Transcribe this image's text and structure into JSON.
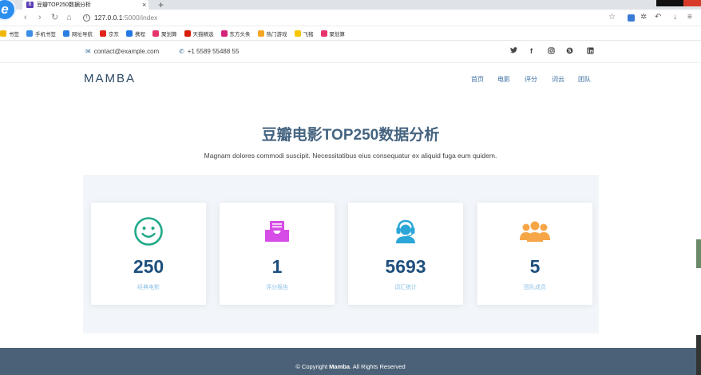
{
  "browser": {
    "tab_favicon": "B",
    "tab_title": "豆瓣TOP250数据分析",
    "tab_close": "×",
    "new_tab": "+",
    "logo_letter": "e",
    "back": "‹",
    "forward": "›",
    "reload": "↻",
    "home": "⌂",
    "info": "i",
    "url_host": "127.0.0.1",
    "url_path": ":5000/index",
    "star": "☆",
    "puzzle": "✲",
    "undo": "↶",
    "download": "↓",
    "menu": "≡",
    "bookmarks": [
      {
        "label": "书签",
        "color": "#f2b705"
      },
      {
        "label": "手机书签",
        "color": "#3a8ee6"
      },
      {
        "label": "网址导航",
        "color": "#2a7de1"
      },
      {
        "label": "京东",
        "color": "#e1251b"
      },
      {
        "label": "携程",
        "color": "#2577e3"
      },
      {
        "label": "聚划算",
        "color": "#e8336d"
      },
      {
        "label": "天猫精选",
        "color": "#d81e06"
      },
      {
        "label": "东方头条",
        "color": "#d4237a"
      },
      {
        "label": "热门游戏",
        "color": "#f5a623"
      },
      {
        "label": "飞猪",
        "color": "#f7c600"
      },
      {
        "label": "聚划算",
        "color": "#e8336d"
      }
    ]
  },
  "topbar": {
    "email": "contact@example.com",
    "phone": "+1 5589 55488 55",
    "social": [
      "twitter",
      "facebook",
      "instagram",
      "skype",
      "linkedin"
    ]
  },
  "header": {
    "logo": "MAMBA",
    "menu": [
      "首页",
      "电影",
      "评分",
      "词云",
      "团队"
    ]
  },
  "section": {
    "title": "豆瓣电影TOP250数据分析",
    "subtitle": "Magnam dolores commodi suscipit. Necessitatibus eius consequatur ex aliquid fuga eum quidem."
  },
  "stats": [
    {
      "icon": "smiley-icon",
      "number": "250",
      "label": "经典电影",
      "color": "#20a988"
    },
    {
      "icon": "inbox-icon",
      "number": "1",
      "label": "评分报告",
      "color": "#d64ce6"
    },
    {
      "icon": "support-agent-icon",
      "number": "5693",
      "label": "词汇统计",
      "color": "#2aa6d8"
    },
    {
      "icon": "team-icon",
      "number": "5",
      "label": "团队成员",
      "color": "#f6a646"
    }
  ],
  "footer": {
    "prefix": "© Copyright ",
    "brand": "Mamba",
    "suffix": ". All Rights Reserved"
  }
}
